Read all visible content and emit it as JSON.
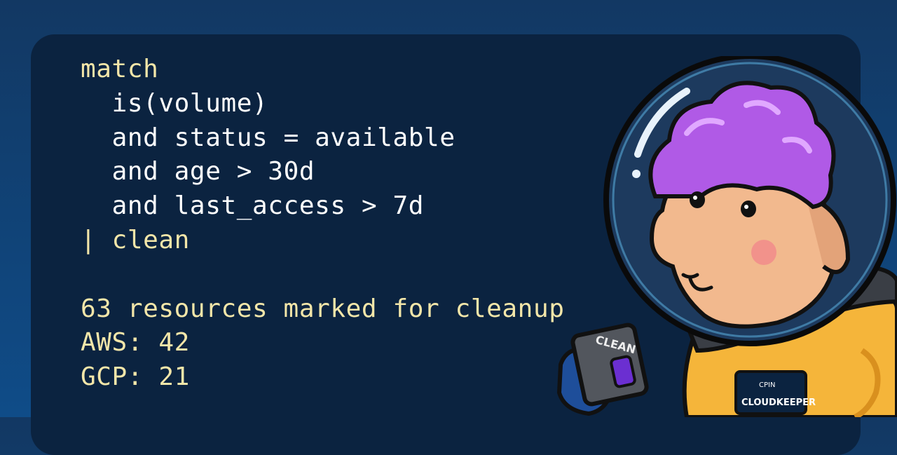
{
  "query": {
    "lines": [
      {
        "indent": "",
        "text": "match",
        "style": "kw"
      },
      {
        "indent": "  ",
        "text": "is(volume)",
        "style": "plain"
      },
      {
        "indent": "  ",
        "text": "and status = available",
        "style": "plain"
      },
      {
        "indent": "  ",
        "text": "and age > 30d",
        "style": "plain"
      },
      {
        "indent": "  ",
        "text": "and last_access > 7d",
        "style": "plain"
      }
    ],
    "pipe_symbol": "|",
    "pipe_command": "clean"
  },
  "result": {
    "summary": "63 resources marked for cleanup",
    "aws": "AWS: 42",
    "gcp": "GCP: 21"
  },
  "mascot": {
    "icon": "astronaut-sheep-mascot-icon",
    "device_label": "CLEAN",
    "badge_small": "CPIN",
    "badge_main": "CLOUDKEEPER"
  },
  "colors": {
    "background": "#123863",
    "panel": "#0b2340",
    "keyword": "#f3e6a9",
    "text": "#ffffff",
    "hair": "#b05ae6",
    "suit": "#f5b53a"
  }
}
